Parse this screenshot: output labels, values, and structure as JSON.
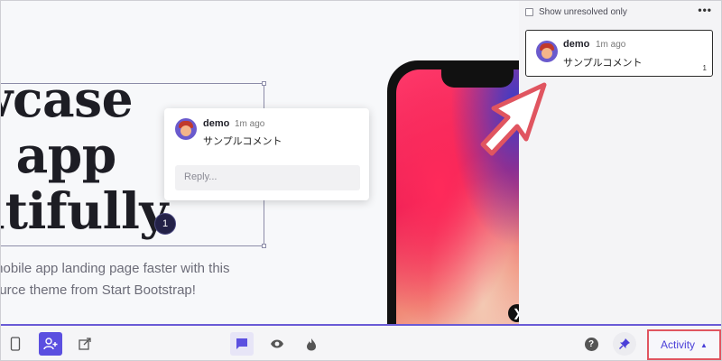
{
  "headline": {
    "lines": [
      "owcase",
      "ur app",
      "autifully."
    ]
  },
  "subtext": {
    "lines": [
      "mobile app landing page faster with this",
      "ource theme from Start Bootstrap!"
    ]
  },
  "pin": {
    "number": "1"
  },
  "popover": {
    "author": "demo",
    "time": "1m ago",
    "text": "サンプルコメント",
    "reply_placeholder": "Reply..."
  },
  "panel": {
    "filter_label": "Show unresolved only",
    "more_label": "•••",
    "card": {
      "author": "demo",
      "time": "1m ago",
      "text": "サンプルコメント",
      "count": "1"
    }
  },
  "toolbar": {
    "activity_label": "Activity",
    "icons": [
      "device-icon",
      "add-user-icon",
      "open-external-icon",
      "comment-icon",
      "eye-icon",
      "flame-icon",
      "help-icon",
      "pin-icon"
    ]
  },
  "colors": {
    "accent": "#5b4fe0",
    "highlight": "#e05560",
    "pin": "#232147"
  }
}
